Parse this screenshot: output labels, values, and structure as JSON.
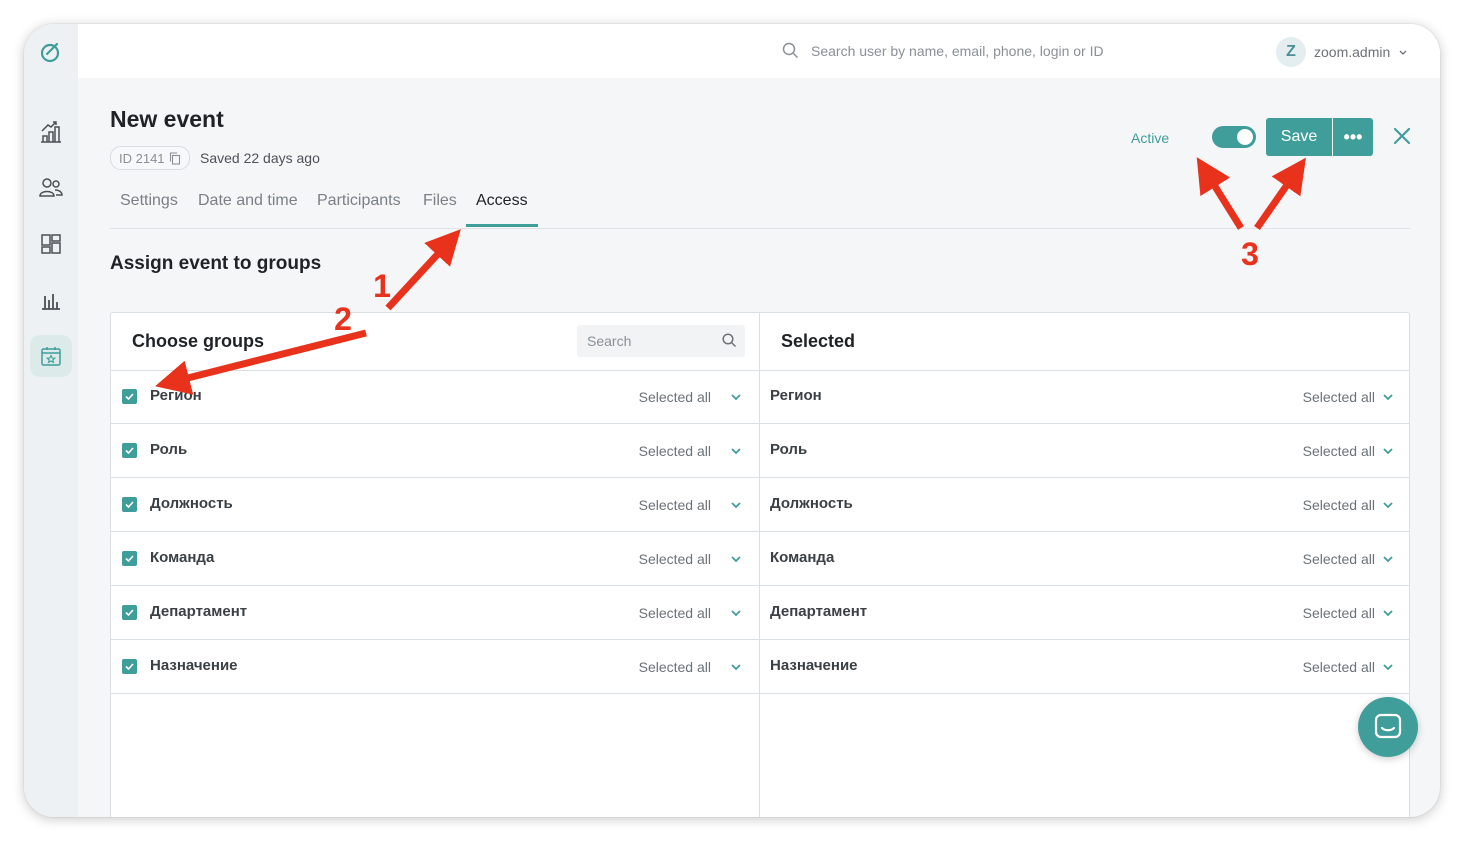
{
  "header": {
    "search_placeholder": "Search user by name, email, phone, login or ID",
    "user_initial": "Z",
    "user_name": "zoom.admin"
  },
  "page": {
    "title": "New event",
    "id_label": "ID 2141",
    "saved_text": "Saved 22 days ago",
    "status_label": "Active",
    "save_label": "Save",
    "more_label": "•••"
  },
  "tabs": [
    {
      "label": "Settings"
    },
    {
      "label": "Date and time"
    },
    {
      "label": "Participants"
    },
    {
      "label": "Files"
    },
    {
      "label": "Access",
      "active": true
    }
  ],
  "section": {
    "title": "Assign event to groups"
  },
  "left_panel": {
    "title": "Choose groups",
    "search_placeholder": "Search",
    "rows": [
      {
        "label": "Регион",
        "status": "Selected all",
        "checked": true
      },
      {
        "label": "Роль",
        "status": "Selected all",
        "checked": true
      },
      {
        "label": "Должность",
        "status": "Selected all",
        "checked": true
      },
      {
        "label": "Команда",
        "status": "Selected all",
        "checked": true
      },
      {
        "label": "Департамент",
        "status": "Selected all",
        "checked": true
      },
      {
        "label": "Назначение",
        "status": "Selected all",
        "checked": true
      }
    ]
  },
  "right_panel": {
    "title": "Selected",
    "rows": [
      {
        "label": "Регион",
        "status": "Selected all"
      },
      {
        "label": "Роль",
        "status": "Selected all"
      },
      {
        "label": "Должность",
        "status": "Selected all"
      },
      {
        "label": "Команда",
        "status": "Selected all"
      },
      {
        "label": "Департамент",
        "status": "Selected all"
      },
      {
        "label": "Назначение",
        "status": "Selected all"
      }
    ]
  },
  "annotations": [
    "1",
    "2",
    "3"
  ],
  "colors": {
    "accent": "#3f9e9a",
    "annotation": "#e8321c"
  }
}
